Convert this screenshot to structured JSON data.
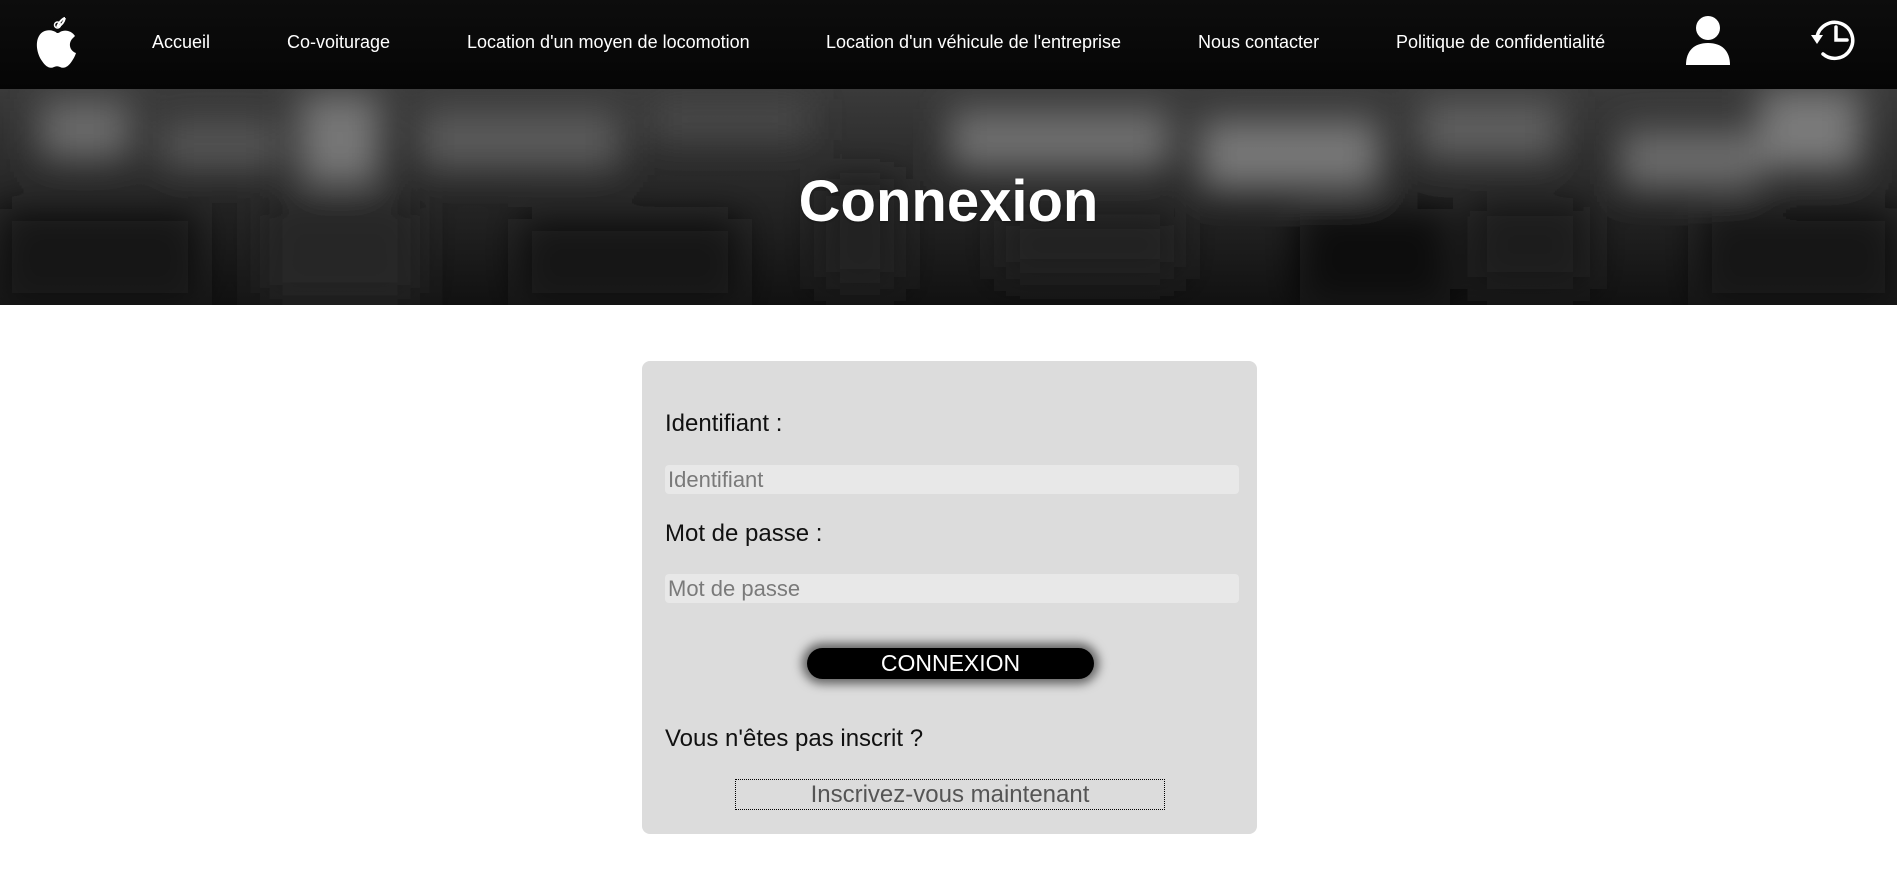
{
  "navbar": {
    "logo_icon": "apple-logo-icon",
    "links": [
      {
        "label": "Accueil"
      },
      {
        "label": "Co-voiturage"
      },
      {
        "label": "Location d'un moyen de locomotion"
      },
      {
        "label": "Location d'un véhicule de l'entreprise"
      },
      {
        "label": "Nous contacter"
      },
      {
        "label": "Politique de confidentialité"
      }
    ],
    "profile_icon": "user-icon",
    "history_icon": "history-clock-icon"
  },
  "hero": {
    "title": "Connexion"
  },
  "login_form": {
    "username_label": "Identifiant :",
    "username_placeholder": "Identifiant",
    "username_value": "",
    "password_label": "Mot de passe :",
    "password_placeholder": "Mot de passe",
    "password_value": "",
    "submit_label": "CONNEXION",
    "not_registered_text": "Vous n'êtes pas inscrit ?",
    "register_label": "Inscrivez-vous maintenant"
  },
  "colors": {
    "navbar_bg": "#0a0a0a",
    "card_bg": "#dcdcdc",
    "button_bg": "#000000",
    "text": "#111111"
  }
}
